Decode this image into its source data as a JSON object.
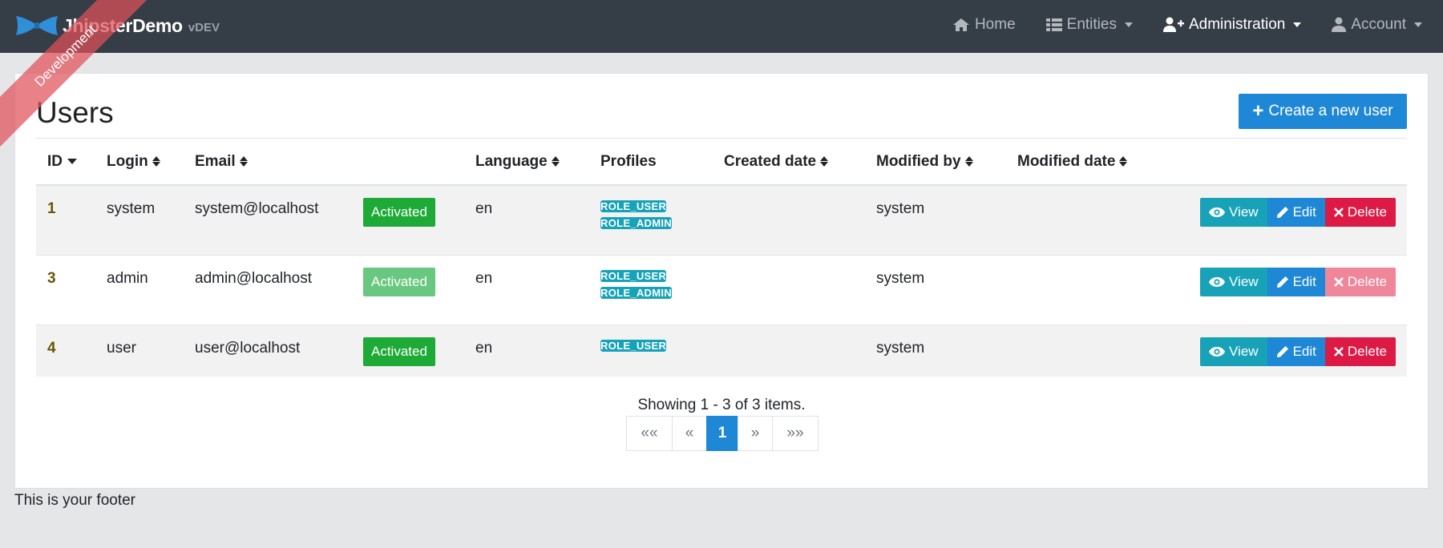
{
  "navbar": {
    "brand_name": "JhipsterDemo",
    "brand_version": "vDEV",
    "ribbon": "Development",
    "items": [
      {
        "label": "Home",
        "icon": "home-icon"
      },
      {
        "label": "Entities",
        "icon": "th-list-icon"
      },
      {
        "label": "Administration",
        "icon": "user-plus-icon"
      },
      {
        "label": "Account",
        "icon": "user-icon"
      }
    ]
  },
  "page": {
    "title": "Users",
    "create_button": "Create a new user"
  },
  "table": {
    "headers": [
      "ID",
      "Login",
      "Email",
      "",
      "Language",
      "Profiles",
      "Created date",
      "Modified by",
      "Modified date",
      ""
    ],
    "rows": [
      {
        "id": "1",
        "login": "system",
        "email": "system@localhost",
        "status": "Activated",
        "language": "en",
        "profiles": [
          "ROLE_USER",
          "ROLE_ADMIN"
        ],
        "created_date": "",
        "modified_by": "system",
        "modified_date": ""
      },
      {
        "id": "3",
        "login": "admin",
        "email": "admin@localhost",
        "status": "Activated",
        "language": "en",
        "profiles": [
          "ROLE_USER",
          "ROLE_ADMIN"
        ],
        "created_date": "",
        "modified_by": "system",
        "modified_date": ""
      },
      {
        "id": "4",
        "login": "user",
        "email": "user@localhost",
        "status": "Activated",
        "language": "en",
        "profiles": [
          "ROLE_USER"
        ],
        "created_date": "",
        "modified_by": "system",
        "modified_date": ""
      }
    ],
    "actions": {
      "view": "View",
      "edit": "Edit",
      "delete": "Delete"
    }
  },
  "pagination": {
    "summary": "Showing 1 - 3 of 3 items.",
    "first": "««",
    "prev": "«",
    "current": "1",
    "next": "»",
    "last": "»»"
  },
  "footer": {
    "text": "This is your footer"
  },
  "colors": {
    "navbar": "#353d47",
    "primary": "#1f88d6",
    "info": "#17a2b8",
    "success": "#1eaa36",
    "danger": "#dc1a45"
  }
}
